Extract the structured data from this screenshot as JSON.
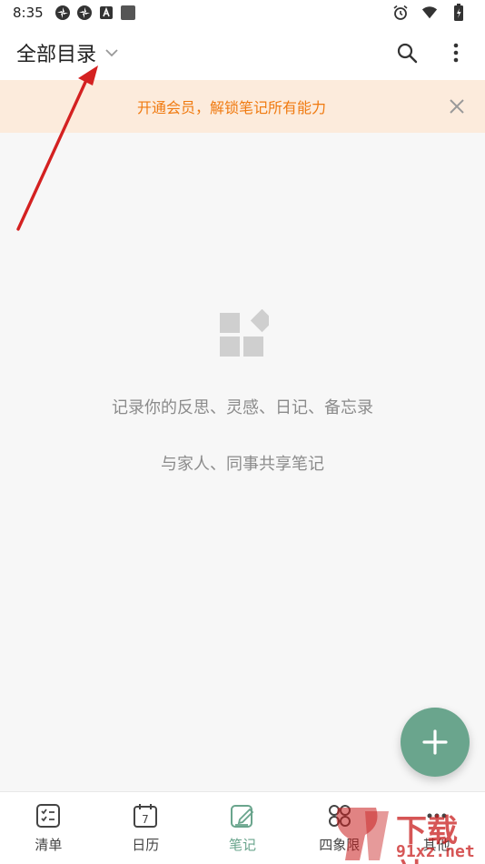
{
  "status_bar": {
    "time": "8:35",
    "left_icons": [
      "pinwheel-icon",
      "pinwheel-icon",
      "a-square-icon",
      "square-icon"
    ],
    "right_icons": [
      "alarm-icon",
      "wifi-icon",
      "battery-icon"
    ]
  },
  "app_bar": {
    "title": "全部目录",
    "icons": [
      "chevron-down-icon",
      "search-icon",
      "more-vert-icon"
    ]
  },
  "banner": {
    "text": "开通会员，解锁笔记所有能力",
    "color": "#f07a10",
    "background": "#fcebdc"
  },
  "empty_state": {
    "icon": "widgets-icon",
    "line1": "记录你的反思、灵感、日记、备忘录",
    "line2": "与家人、同事共享笔记"
  },
  "fab": {
    "icon": "plus-icon",
    "color": "#6aa58d"
  },
  "tabs": [
    {
      "label": "清单",
      "icon": "checklist-icon",
      "active": false
    },
    {
      "label": "日历",
      "icon": "calendar-icon",
      "day": "7",
      "active": false
    },
    {
      "label": "笔记",
      "icon": "note-edit-icon",
      "active": true
    },
    {
      "label": "四象限",
      "icon": "quadrant-icon",
      "active": false
    },
    {
      "label": "其他",
      "icon": "more-icon",
      "active": false
    }
  ],
  "watermark": {
    "main": "下载站",
    "sub": "91xz.net"
  },
  "accent_color": "#6aa58d"
}
